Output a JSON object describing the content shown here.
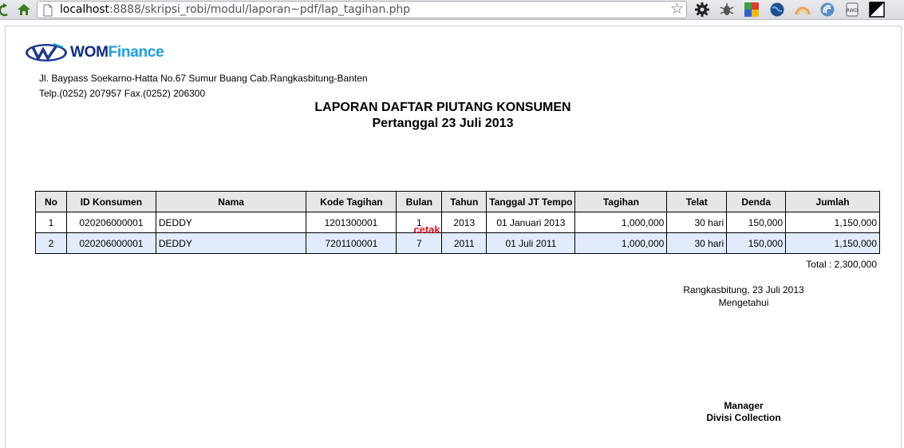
{
  "browser": {
    "url_host": "localhost",
    "url_path": ":8888/skripsi_robi/modul/laporan~pdf/lap_tagihan.php",
    "icons": [
      "reload-icon",
      "home-icon",
      "page-icon",
      "bookmark-star-icon",
      "gear-icon",
      "bug-icon",
      "puzzle-icon",
      "globe-icon",
      "rainbow-icon",
      "signal-icon",
      "rwd-icon",
      "contrast-icon"
    ]
  },
  "company": {
    "logo_wom": "WOM",
    "logo_finance": "Finance",
    "address": "Jl. Baypass Soekarno-Hatta No.67 Sumur Buang Cab.Rangkasbitung-Banten",
    "phone": "Telp.(0252) 207957 Fax.(0252) 206300"
  },
  "report": {
    "title": "LAPORAN DAFTAR PIUTANG KONSUMEN",
    "subtitle": "Pertanggal 23 Juli 2013",
    "columns": [
      "No",
      "ID Konsumen",
      "Nama",
      "Kode Tagihan",
      "Bulan",
      "Tahun",
      "Tanggal JT Tempo",
      "Tagihan",
      "Telat",
      "Denda",
      "Jumlah"
    ],
    "rows": [
      {
        "no": "1",
        "id": "020206000001",
        "nama": "DEDDY",
        "kode": "1201300001",
        "bulan": "1",
        "tahun": "2013",
        "jt": "01 Januari 2013",
        "tagihan": "1,000,000",
        "telat": "30 hari",
        "denda": "150,000",
        "jumlah": "1,150,000"
      },
      {
        "no": "2",
        "id": "020206000001",
        "nama": "DEDDY",
        "kode": "7201100001",
        "bulan": "7",
        "tahun": "2011",
        "jt": "01 Juli 2011",
        "tagihan": "1,000,000",
        "telat": "30 hari",
        "denda": "150,000",
        "jumlah": "1,150,000"
      }
    ],
    "cetak_label": "cetak",
    "total": "Total : 2,300,000"
  },
  "signature": {
    "place_date": "Rangkasbitung, 23 Juli 2013",
    "acknowledged": "Mengetahui",
    "role": "Manager",
    "division": "Divisi Collection"
  },
  "colors": {
    "alt_row": "#e1ebfb",
    "header_bg": "#e6e6e6",
    "cetak": "#e2101a",
    "logo_dark": "#0d2d87",
    "logo_light": "#1aa0e0"
  }
}
